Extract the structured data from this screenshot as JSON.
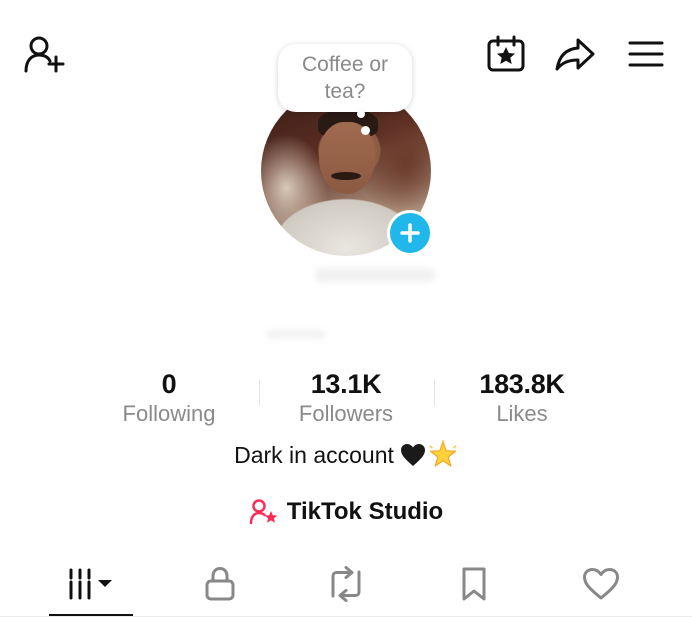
{
  "header": {
    "icons": [
      "add-friend-icon",
      "calendar-star-icon",
      "share-icon",
      "menu-icon"
    ]
  },
  "profile": {
    "bubble_text_line1": "Coffee or",
    "bubble_text_line2": "tea?",
    "add_story_icon": "plus-icon"
  },
  "stats": [
    {
      "value": "0",
      "label": "Following"
    },
    {
      "value": "13.1K",
      "label": "Followers"
    },
    {
      "value": "183.8K",
      "label": "Likes"
    }
  ],
  "bio": {
    "text": "Dark in account",
    "emojis": [
      "black-heart",
      "glowing-star"
    ]
  },
  "studio": {
    "label": "TikTok Studio",
    "icon": "creator-star-icon",
    "icon_color": "#fe2c55"
  },
  "tabs": [
    {
      "name": "videos",
      "icon": "grid-dropdown-icon",
      "active": true
    },
    {
      "name": "private",
      "icon": "lock-icon",
      "active": false
    },
    {
      "name": "reposts",
      "icon": "repost-icon",
      "active": false
    },
    {
      "name": "favorites",
      "icon": "bookmark-icon",
      "active": false
    },
    {
      "name": "liked",
      "icon": "heart-icon",
      "active": false
    }
  ],
  "colors": {
    "accent_blue": "#20b8ea",
    "brand_pink": "#fe2c55",
    "muted_text": "#8a8a8a"
  }
}
